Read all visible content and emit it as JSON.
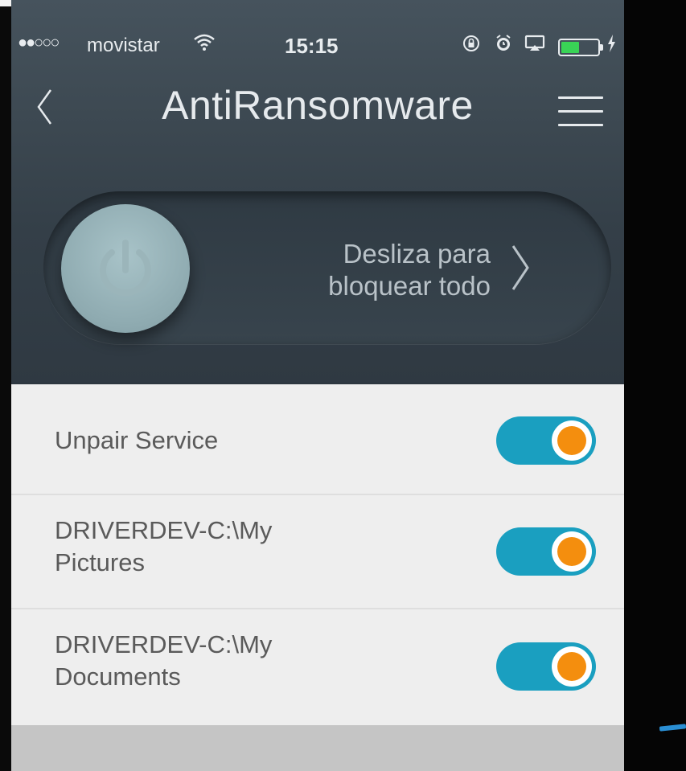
{
  "status_bar": {
    "signal": "●●○○○",
    "carrier": "movistar",
    "wifi_icon": "wifi-icon",
    "time": "15:15",
    "battery_charge_fraction": 0.45
  },
  "nav": {
    "title": "AntiRansomware"
  },
  "lock_slider": {
    "line1": "Desliza para",
    "line2": "bloquear todo"
  },
  "settings": {
    "items": [
      {
        "label": "Unpair Service",
        "enabled": true
      },
      {
        "label_line1": "DRIVERDEV-C:\\My",
        "label_line2": "Pictures",
        "enabled": true
      },
      {
        "label_line1": "DRIVERDEV-C:\\My",
        "label_line2": "Documents",
        "enabled": true
      }
    ]
  },
  "colors": {
    "toggle_track": "#1a9fc0",
    "toggle_thumb_dot": "#f48e0e",
    "header_bg": "#3d4952",
    "list_bg": "#eeeeee"
  }
}
